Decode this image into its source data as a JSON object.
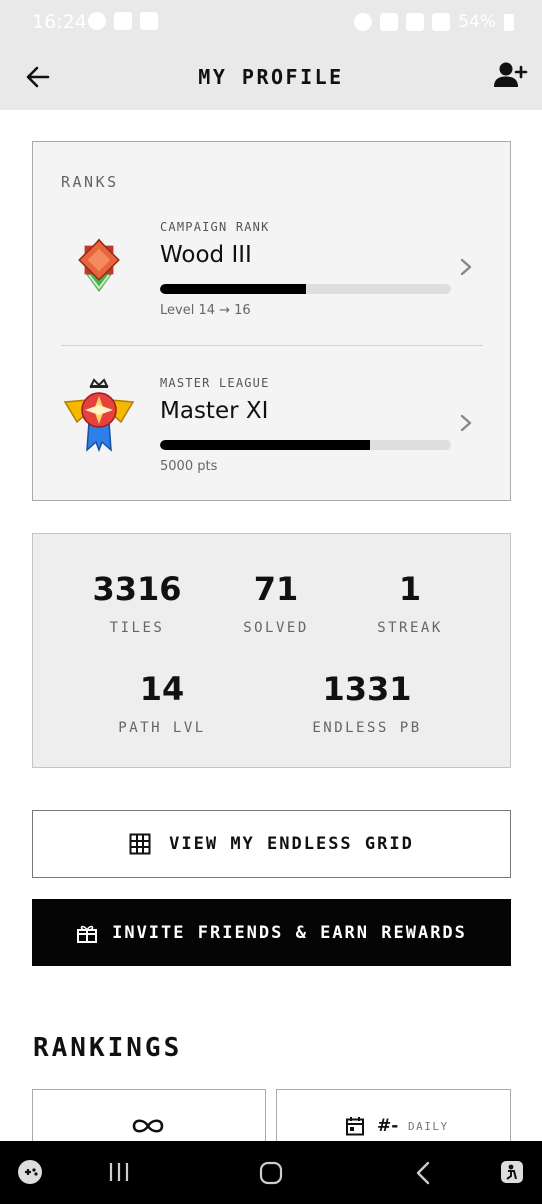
{
  "status_bar": {
    "time": "16:24",
    "battery": "54%"
  },
  "app_bar": {
    "title": "MY PROFILE",
    "icons": [
      "back-arrow-icon",
      "add-friend-icon"
    ]
  },
  "ranks": {
    "label": "RANKS",
    "items": [
      {
        "category": "CAMPAIGN RANK",
        "name": "Wood III",
        "progress": 0.5,
        "detail": "Level 14 → 16",
        "icon": "wood-rank-badge-icon"
      },
      {
        "category": "MASTER LEAGUE",
        "name": "Master XI",
        "progress": 0.72,
        "detail": "5000 pts",
        "icon": "master-league-badge-icon"
      }
    ]
  },
  "stats": {
    "row1": [
      {
        "value": "3316",
        "label": "TILES"
      },
      {
        "value": "71",
        "label": "SOLVED"
      },
      {
        "value": "1",
        "label": "STREAK"
      }
    ],
    "row2": [
      {
        "value": "14",
        "label": "PATH LVL"
      },
      {
        "value": "1331",
        "label": "ENDLESS PB"
      }
    ]
  },
  "buttons": {
    "view_grid": "VIEW MY ENDLESS GRID",
    "invite": "INVITE FRIENDS & EARN REWARDS"
  },
  "rankings": {
    "title": "RANKINGS",
    "tiles": [
      {
        "icon": "infinity-icon"
      },
      {
        "icon": "calendar-icon",
        "value": "#-",
        "label": "DAILY"
      }
    ]
  },
  "colors": {
    "accent": "#000000",
    "header_bg": "#e9e9e9",
    "card_bg": "#f4f4f4"
  }
}
